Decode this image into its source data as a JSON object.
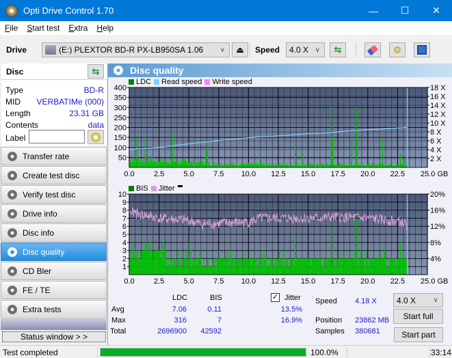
{
  "window": {
    "title": "Opti Drive Control 1.70",
    "minimize": "—",
    "maximize": "☐",
    "close": "✕"
  },
  "menu": [
    {
      "label": "File",
      "u": "F",
      "rest": "ile"
    },
    {
      "label": "Start test",
      "u": "S",
      "rest": "tart test"
    },
    {
      "label": "Extra",
      "u": "E",
      "rest": "xtra",
      "pre": ""
    },
    {
      "label": "Help",
      "u": "H",
      "rest": "elp"
    }
  ],
  "toolbar": {
    "drive_label": "Drive",
    "drive_value": "(E:)  PLEXTOR BD-R  PX-LB950SA 1.06",
    "speed_label": "Speed",
    "speed_value": "4.0 X"
  },
  "disc": {
    "header": "Disc",
    "rows": [
      {
        "key": "Type",
        "value": "BD-R"
      },
      {
        "key": "MID",
        "value": "VERBATIMe (000)"
      },
      {
        "key": "Length",
        "value": "23.31 GB"
      },
      {
        "key": "Contents",
        "value": "data"
      }
    ],
    "label_key": "Label",
    "label_value": ""
  },
  "nav": [
    {
      "label": "Transfer rate",
      "active": false
    },
    {
      "label": "Create test disc",
      "active": false
    },
    {
      "label": "Verify test disc",
      "active": false
    },
    {
      "label": "Drive info",
      "active": false
    },
    {
      "label": "Disc info",
      "active": false
    },
    {
      "label": "Disc quality",
      "active": true
    },
    {
      "label": "CD Bler",
      "active": false
    },
    {
      "label": "FE / TE",
      "active": false
    },
    {
      "label": "Extra tests",
      "active": false
    }
  ],
  "status_window_label": "Status window > >",
  "panel_title": "Disc quality",
  "colors": {
    "ldc": "#00c000",
    "read_speed": "#7fd0ff",
    "write_speed": "#ff80ff",
    "bis": "#00c000",
    "jitter": "#d8a0d8",
    "plot_bg_top": "#4a5878",
    "plot_bg_bottom": "#8898b8"
  },
  "chart_data": [
    {
      "type": "bar",
      "title": "LDC",
      "legend": [
        "LDC",
        "Read speed",
        "Write speed"
      ],
      "x_ticks": [
        "0.0",
        "2.5",
        "5.0",
        "7.5",
        "10.0",
        "12.5",
        "15.0",
        "17.5",
        "20.0",
        "22.5",
        "25.0 GB"
      ],
      "xlim": [
        0,
        25
      ],
      "y_ticks": [
        "50",
        "100",
        "150",
        "200",
        "250",
        "300",
        "350",
        "400"
      ],
      "ylim": [
        0,
        400
      ],
      "y2_ticks": [
        "2 X",
        "4 X",
        "6 X",
        "8 X",
        "10 X",
        "12 X",
        "14 X",
        "16 X",
        "18 X"
      ],
      "y2lim": [
        0,
        18
      ],
      "end_marker_gb": 23.31,
      "ldc_baseline": [
        [
          0,
          45
        ],
        [
          2.5,
          40
        ],
        [
          5,
          32
        ],
        [
          7.5,
          20
        ],
        [
          10,
          18
        ],
        [
          12.5,
          16
        ],
        [
          15,
          15
        ],
        [
          17.5,
          16
        ],
        [
          20,
          16
        ],
        [
          22.5,
          16
        ],
        [
          23.3,
          16
        ]
      ],
      "ldc_spikes": [
        [
          0.6,
          148
        ],
        [
          1.3,
          160
        ],
        [
          1.8,
          60
        ],
        [
          3.6,
          170
        ],
        [
          6.4,
          100
        ],
        [
          6.5,
          90
        ],
        [
          11,
          50
        ],
        [
          13.9,
          130
        ],
        [
          14.5,
          60
        ],
        [
          16.9,
          305
        ],
        [
          17.0,
          150
        ],
        [
          18.6,
          140
        ],
        [
          19.0,
          300
        ],
        [
          19.05,
          190
        ],
        [
          21.2,
          145
        ],
        [
          22.7,
          70
        ],
        [
          23.1,
          40
        ]
      ],
      "read_speed": [
        [
          0,
          4.0
        ],
        [
          1,
          4.2
        ],
        [
          2,
          4.4
        ],
        [
          3,
          4.6
        ],
        [
          4,
          5.0
        ],
        [
          5,
          5.3
        ],
        [
          6,
          5.6
        ],
        [
          7,
          5.9
        ],
        [
          8,
          6.2
        ],
        [
          9,
          6.4
        ],
        [
          10,
          6.7
        ],
        [
          11,
          6.9
        ],
        [
          12,
          7.0
        ],
        [
          13,
          7.2
        ],
        [
          14,
          7.4
        ],
        [
          15,
          7.6
        ],
        [
          16,
          7.7
        ],
        [
          17,
          7.9
        ],
        [
          18,
          8.1
        ],
        [
          19,
          8.3
        ],
        [
          20,
          8.5
        ],
        [
          21,
          8.6
        ],
        [
          22,
          8.8
        ],
        [
          23.3,
          9.0
        ]
      ]
    },
    {
      "type": "bar",
      "title": "BIS",
      "legend": [
        "BIS",
        "Jitter"
      ],
      "x_ticks": [
        "0.0",
        "2.5",
        "5.0",
        "7.5",
        "10.0",
        "12.5",
        "15.0",
        "17.5",
        "20.0",
        "22.5",
        "25.0 GB"
      ],
      "xlim": [
        0,
        25
      ],
      "y_ticks": [
        "1",
        "2",
        "3",
        "4",
        "5",
        "6",
        "7",
        "8",
        "9",
        "10"
      ],
      "ylim": [
        0,
        10
      ],
      "y2_ticks": [
        "4%",
        "8%",
        "12%",
        "16%",
        "20%"
      ],
      "y2lim": [
        0,
        20
      ],
      "end_marker_gb": 23.31,
      "bis_baseline": [
        [
          0,
          3
        ],
        [
          3.1,
          2
        ],
        [
          6,
          1
        ],
        [
          7,
          2
        ],
        [
          23.3,
          2
        ]
      ],
      "bis_spikes": [
        [
          0.3,
          4
        ],
        [
          1.3,
          4
        ],
        [
          2.7,
          4
        ],
        [
          5,
          4
        ],
        [
          13.9,
          5
        ],
        [
          16.9,
          6
        ],
        [
          19.0,
          7
        ],
        [
          22.7,
          4
        ]
      ],
      "jitter_avg_pct": 13.5,
      "jitter_profile": [
        [
          0,
          15.5
        ],
        [
          2.5,
          14
        ],
        [
          5,
          13.5
        ],
        [
          6,
          12.5
        ],
        [
          8,
          12.8
        ],
        [
          10,
          13
        ],
        [
          11,
          14
        ],
        [
          15,
          14
        ],
        [
          17.5,
          14.2
        ],
        [
          20,
          14
        ],
        [
          22.5,
          13.2
        ],
        [
          23.3,
          12.5
        ]
      ]
    }
  ],
  "stats": {
    "col_ldc": "LDC",
    "col_bis": "BIS",
    "jitter_checked": true,
    "jitter_label": "Jitter",
    "rows": [
      {
        "label": "Avg",
        "ldc": "7.06",
        "bis": "0.11",
        "jitter": "13.5%"
      },
      {
        "label": "Max",
        "ldc": "316",
        "bis": "7",
        "jitter": "16.9%"
      },
      {
        "label": "Total",
        "ldc": "2696900",
        "bis": "42592",
        "jitter": ""
      }
    ],
    "speed_label": "Speed",
    "speed_value": "4.18 X",
    "position_label": "Position",
    "position_value": "23862 MB",
    "samples_label": "Samples",
    "samples_value": "380681",
    "speed_select": "4.0 X",
    "start_full": "Start full",
    "start_part": "Start part"
  },
  "status": {
    "text": "Test completed",
    "progress_pct": 100,
    "progress_text": "100.0%",
    "time": "33:14"
  }
}
